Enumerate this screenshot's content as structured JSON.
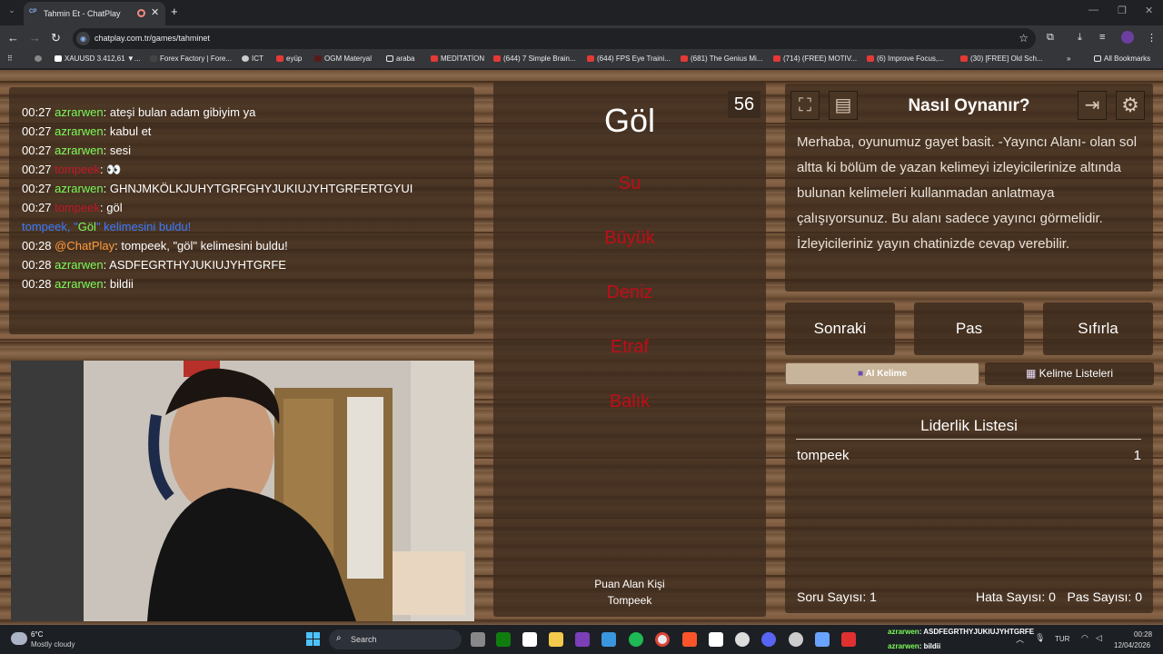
{
  "browser": {
    "tab_title": "Tahmin Et - ChatPlay",
    "tab_favicon": "CP",
    "url": "chatplay.com.tr/games/tahminet",
    "bookmarks": [
      "XAUUSD 3.412,61 ▼...",
      "Forex Factory | Fore...",
      "ICT",
      "eyüp",
      "OGM Materyal",
      "araba",
      "MEDİTATİON",
      "(644) 7 Simple Brain...",
      "(644) FPS Eye Traini...",
      "(681) The Genius Mi...",
      "(714) (FREE) MOTIV...",
      "(6) Improve Focus,...",
      "(30) [FREE] Old Sch...",
      "All Bookmarks"
    ]
  },
  "chat": {
    "messages": [
      {
        "time": "00:27",
        "user": "azrarwen",
        "sep": ": ",
        "text": "ateşi bulan adam gibiyim ya",
        "color": "green"
      },
      {
        "time": "00:27",
        "user": "azrarwen",
        "sep": ": ",
        "text": "kabul et",
        "color": "green"
      },
      {
        "time": "00:27",
        "user": "azrarwen",
        "sep": ": ",
        "text": "sesi",
        "color": "green"
      },
      {
        "time": "00:27",
        "user": "tompeek",
        "sep": ": ",
        "text": "👀",
        "color": "red"
      },
      {
        "time": "00:27",
        "user": "azrarwen",
        "sep": ": ",
        "text": "GHNJMKÖLKJUHYTGRFGHYJUKIUJYHTGRFERTGYUI",
        "color": "green"
      },
      {
        "time": "00:27",
        "user": "tompeek",
        "sep": ": ",
        "text": "göl",
        "color": "red"
      },
      {
        "time": "00:28",
        "user": "@ChatPlay",
        "sep": ": ",
        "text": "tompeek, \"göl\" kelimesini buldu!",
        "color": "orange"
      },
      {
        "time": "00:28",
        "user": "azrarwen",
        "sep": ": ",
        "text": "ASDFEGRTHYJUKIUJYHTGRFE",
        "color": "green"
      },
      {
        "time": "00:28",
        "user": "azrarwen",
        "sep": ": ",
        "text": "bildii",
        "color": "green"
      }
    ],
    "system_prefix": "tompeek, \"",
    "system_word": "Göl",
    "system_suffix": "\" kelimesini buldu!"
  },
  "word_card": {
    "timer": "56",
    "main_word": "Göl",
    "forbidden": [
      "Su",
      "Büyük",
      "Deniz",
      "Etraf",
      "Balık"
    ],
    "scorer_label": "Puan Alan Kişi",
    "scorer_name": "Tompeek"
  },
  "info": {
    "title": "Nasıl Oynanır?",
    "body": "Merhaba, oyunumuz gayet basit. -Yayıncı Alanı- olan sol altta ki bölüm de yazan kelimeyi izleyicilerinize altında bulunan kelimeleri kullanmadan anlatmaya çalışıyorsunuz. Bu alanı sadece yayıncı görmelidir. İzleyicileriniz yayın chatinizde cevap verebilir."
  },
  "controls": {
    "next": "Sonraki",
    "pass": "Pas",
    "reset": "Sıfırla",
    "ai_word": "AI Kelime",
    "word_lists": "Kelime Listeleri"
  },
  "leaderboard": {
    "title": "Liderlik Listesi",
    "rows": [
      {
        "name": "tompeek",
        "score": "1"
      }
    ],
    "question_count": "Soru Sayısı: 1",
    "error_count": "Hata Sayısı: 0",
    "pass_count": "Pas Sayısı: 0"
  },
  "taskbar": {
    "temp": "6°C",
    "weather": "Mostly cloudy",
    "search": "Search",
    "ticker1_user": "azrarwen",
    "ticker1_text": ": ASDFEGRTHYJUKIUJYHTGRFE",
    "ticker2_user": "azrarwen",
    "ticker2_text": ": bildii",
    "lang": "TUR",
    "time": "00:28",
    "date": "12/04/2026"
  }
}
